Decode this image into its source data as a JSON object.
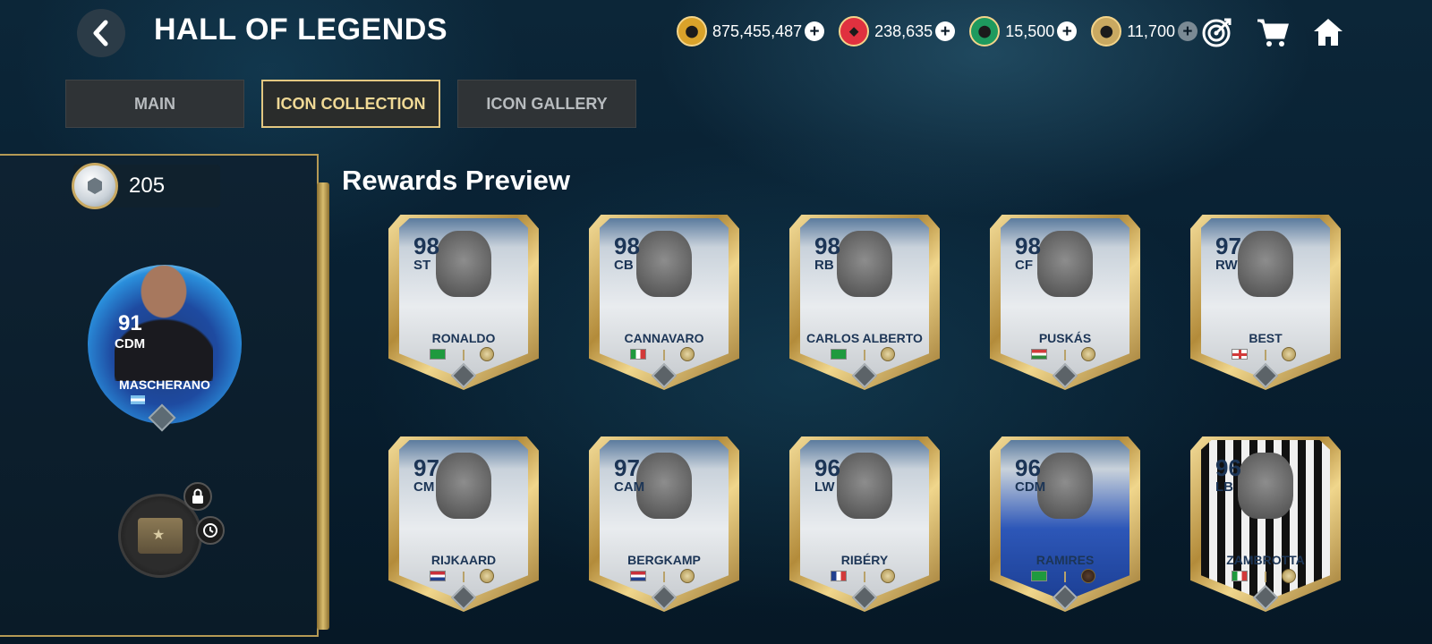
{
  "header": {
    "title": "HALL OF LEGENDS",
    "currencies": [
      {
        "name": "coins",
        "value": "875,455,487",
        "color": "#d9a22a",
        "dim": false
      },
      {
        "name": "gems",
        "value": "238,635",
        "color": "#e0313f",
        "dim": false
      },
      {
        "name": "fc-points",
        "value": "15,500",
        "color": "#1e9a5e",
        "dim": false
      },
      {
        "name": "icon-tokens",
        "value": "11,700",
        "color": "#c9a961",
        "dim": true
      }
    ],
    "icons": [
      "target-icon",
      "cart-icon",
      "home-icon"
    ]
  },
  "tabs": [
    {
      "label": "MAIN",
      "active": false
    },
    {
      "label": "ICON COLLECTION",
      "active": true
    },
    {
      "label": "ICON GALLERY",
      "active": false
    }
  ],
  "left_panel": {
    "token_count": "205",
    "featured": {
      "rating": "91",
      "position": "CDM",
      "name": "MASCHERANO"
    }
  },
  "rewards": {
    "title": "Rewards Preview",
    "cards": [
      {
        "rating": "98",
        "position": "ST",
        "name": "RONALDO",
        "flag": "brazil",
        "style": "grey"
      },
      {
        "rating": "98",
        "position": "CB",
        "name": "CANNAVARO",
        "flag": "italy",
        "style": "grey"
      },
      {
        "rating": "98",
        "position": "RB",
        "name": "CARLOS ALBERTO",
        "flag": "brazil",
        "style": "grey"
      },
      {
        "rating": "98",
        "position": "CF",
        "name": "PUSKÁS",
        "flag": "hungary",
        "style": "grey"
      },
      {
        "rating": "97",
        "position": "RW",
        "name": "BEST",
        "flag": "england",
        "style": "grey"
      },
      {
        "rating": "97",
        "position": "CM",
        "name": "RIJKAARD",
        "flag": "netherlands",
        "style": "grey"
      },
      {
        "rating": "97",
        "position": "CAM",
        "name": "BERGKAMP",
        "flag": "netherlands",
        "style": "grey"
      },
      {
        "rating": "96",
        "position": "LW",
        "name": "RIBÉRY",
        "flag": "france",
        "style": "grey"
      },
      {
        "rating": "96",
        "position": "CDM",
        "name": "RAMIRES",
        "flag": "brazil",
        "style": "blue"
      },
      {
        "rating": "96",
        "position": "LB",
        "name": "ZAMBROTTA",
        "flag": "italy",
        "style": "stripes"
      }
    ]
  }
}
